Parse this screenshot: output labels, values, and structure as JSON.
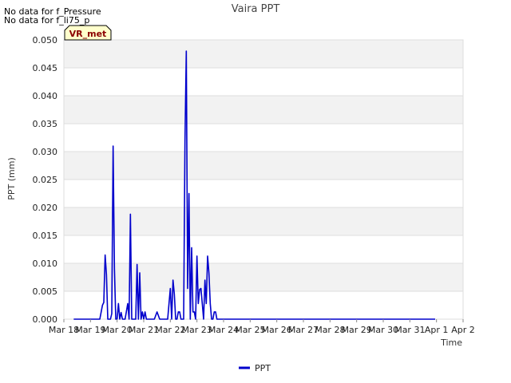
{
  "notes": [
    "No data for f_Pressure",
    "No data for f_li75_p"
  ],
  "badge": {
    "label": "VR_met",
    "fill": "#ffffcc",
    "text_color": "#8b0000"
  },
  "chart_data": {
    "type": "line",
    "title": "Vaira PPT",
    "xlabel": "Time",
    "ylabel": "PPT (mm)",
    "ylim": [
      0,
      0.05
    ],
    "xlim": [
      0,
      15
    ],
    "yticks": [
      "0.000",
      "0.005",
      "0.010",
      "0.015",
      "0.020",
      "0.025",
      "0.030",
      "0.035",
      "0.040",
      "0.045",
      "0.050"
    ],
    "xticks": [
      "Mar 18",
      "Mar 19",
      "Mar 20",
      "Mar 21",
      "Mar 22",
      "Mar 23",
      "Mar 24",
      "Mar 25",
      "Mar 26",
      "Mar 27",
      "Mar 28",
      "Mar 29",
      "Mar 30",
      "Mar 31",
      "Apr 1",
      "Apr 2"
    ],
    "grid": true,
    "band_colors": [
      "#f2f2f2",
      "#ffffff"
    ],
    "legend": {
      "position": "bottom-center"
    },
    "series": [
      {
        "name": "PPT",
        "color": "#0000cc",
        "x": [
          0.37,
          1.35,
          1.45,
          1.5,
          1.55,
          1.6,
          1.65,
          1.7,
          1.75,
          1.8,
          1.85,
          1.9,
          1.95,
          2.0,
          2.05,
          2.1,
          2.15,
          2.2,
          2.25,
          2.3,
          2.4,
          2.45,
          2.5,
          2.55,
          2.6,
          2.65,
          2.7,
          2.75,
          2.8,
          2.85,
          2.9,
          2.95,
          3.0,
          3.05,
          3.1,
          3.15,
          3.2,
          3.25,
          3.3,
          3.35,
          3.4,
          3.5,
          3.6,
          3.65,
          3.7,
          3.8,
          3.85,
          3.9,
          3.95,
          4.0,
          4.05,
          4.1,
          4.15,
          4.2,
          4.25,
          4.3,
          4.35,
          4.4,
          4.45,
          4.5,
          4.55,
          4.6,
          4.65,
          4.7,
          4.75,
          4.8,
          4.85,
          4.9,
          4.95,
          5.0,
          5.05,
          5.1,
          5.15,
          5.2,
          5.25,
          5.3,
          5.35,
          5.4,
          5.45,
          5.5,
          5.55,
          5.6,
          5.65,
          5.7,
          5.75,
          5.8,
          5.85,
          5.9,
          5.95,
          6.0,
          6.05,
          6.1,
          6.15,
          6.2,
          10.0,
          10.05,
          10.1,
          10.15,
          10.2,
          10.25,
          10.3,
          10.35,
          10.4,
          10.45,
          10.5,
          10.55,
          10.6,
          10.65,
          10.7,
          11.5,
          11.55,
          11.6,
          11.65,
          11.7,
          11.75,
          11.8,
          11.85,
          11.9,
          11.95,
          12.0,
          12.1,
          12.15,
          12.2,
          12.25,
          12.3,
          12.4,
          13.95
        ],
        "y": [
          0.0,
          0.0,
          0.0025,
          0.003,
          0.0115,
          0.008,
          0.0,
          0.0,
          0.0,
          0.001,
          0.031,
          0.009,
          0.0,
          0.0,
          0.0028,
          0.0,
          0.0012,
          0.0,
          0.0,
          0.0,
          0.0028,
          0.0,
          0.0188,
          0.0,
          0.0,
          0.0,
          0.0,
          0.0098,
          0.0,
          0.0083,
          0.0,
          0.0013,
          0.0,
          0.0013,
          0.0,
          0.0,
          0.0,
          0.0,
          0.0,
          0.0,
          0.0,
          0.0013,
          0.0,
          0.0,
          0.0,
          0.0,
          0.0,
          0.0,
          0.0028,
          0.0055,
          0.0,
          0.007,
          0.0045,
          0.0,
          0.0,
          0.0013,
          0.0013,
          0.0,
          0.0,
          0.0,
          0.032,
          0.048,
          0.0055,
          0.0225,
          0.0,
          0.0128,
          0.0013,
          0.0013,
          0.0,
          0.0113,
          0.0028,
          0.0053,
          0.0055,
          0.0028,
          0.0,
          0.007,
          0.0028,
          0.0113,
          0.0083,
          0.0028,
          0.0,
          0.0,
          0.0013,
          0.0013,
          0.0,
          0.0,
          0.0,
          0.0,
          0.0,
          0.0,
          0.0,
          0.0,
          0.0,
          0.0,
          0.0,
          0.0,
          0.0,
          0.0,
          0.0,
          0.0,
          0.0,
          0.0,
          0.0,
          0.0,
          0.0,
          0.0,
          0.0,
          0.0,
          0.0,
          0.0,
          0.0,
          0.0,
          0.0,
          0.0,
          0.0,
          0.0,
          0.0,
          0.0,
          0.0,
          0.0,
          0.0,
          0.0,
          0.0,
          0.0,
          0.0,
          0.0,
          0.0
        ]
      }
    ]
  }
}
